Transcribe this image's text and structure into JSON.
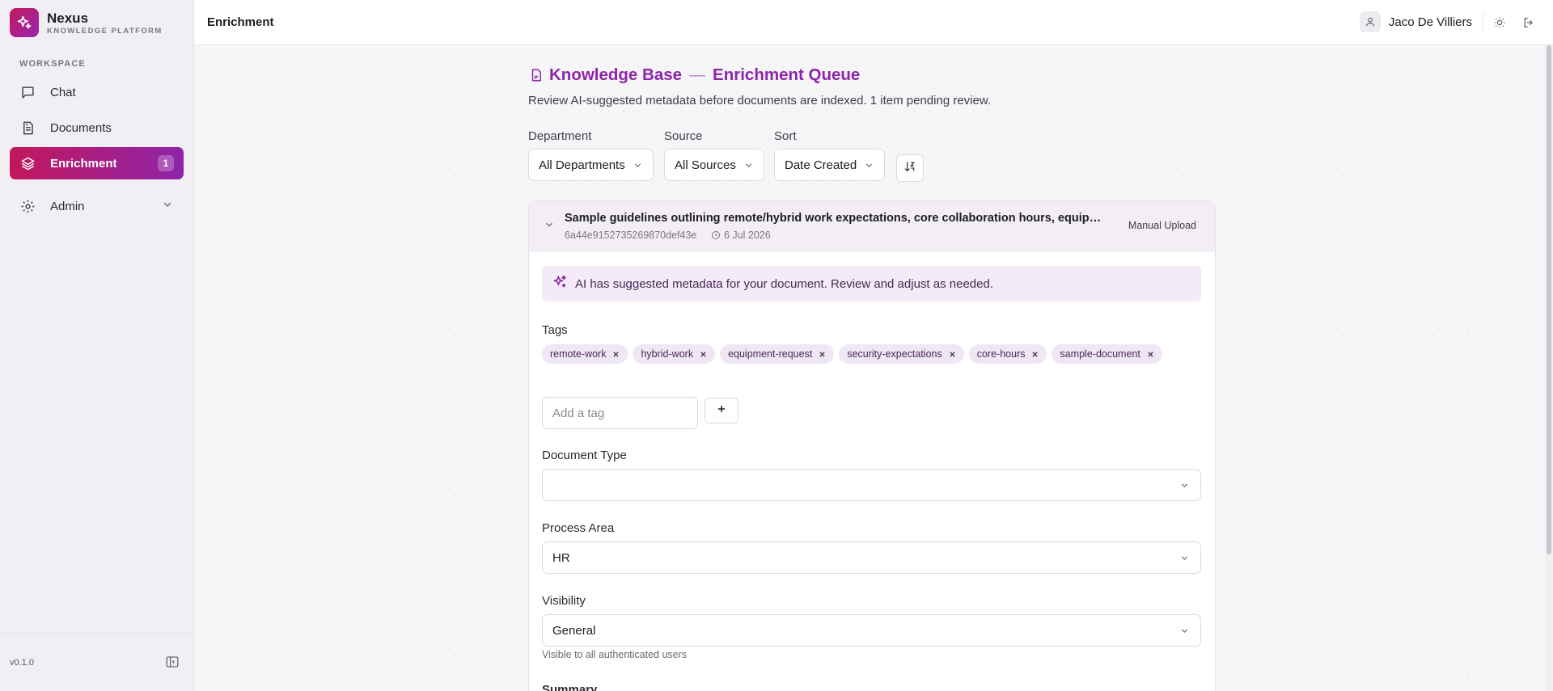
{
  "brand": {
    "name": "Nexus",
    "subtitle": "KNOWLEDGE PLATFORM"
  },
  "sidebar": {
    "section_label": "WORKSPACE",
    "items": [
      {
        "label": "Chat",
        "icon": "message-square-icon"
      },
      {
        "label": "Documents",
        "icon": "file-text-icon"
      },
      {
        "label": "Enrichment",
        "icon": "layers-icon",
        "badge": "1",
        "active": true
      },
      {
        "label": "Admin",
        "icon": "gear-icon"
      }
    ],
    "version": "v0.1.0"
  },
  "topbar": {
    "title": "Enrichment",
    "user_name": "Jaco De Villiers"
  },
  "page": {
    "title_part1": "Knowledge Base",
    "separator": "—",
    "title_part2": "Enrichment Queue",
    "description": "Review AI-suggested metadata before documents are indexed. 1 item pending review."
  },
  "filters": {
    "department": {
      "label": "Department",
      "value": "All Departments"
    },
    "source": {
      "label": "Source",
      "value": "All Sources"
    },
    "sort": {
      "label": "Sort",
      "value": "Date Created"
    }
  },
  "document": {
    "title": "Sample guidelines outlining remote/hybrid work expectations, core collaboration hours, equipment request process, and security expectations",
    "id": "6a44e9152735269870def43e",
    "date": "6 Jul 2026",
    "source": "Manual Upload",
    "ai_banner": "AI has suggested metadata for your document. Review and adjust as needed.",
    "tags_label": "Tags",
    "tags": [
      "remote-work",
      "hybrid-work",
      "equipment-request",
      "security-expectations",
      "core-hours",
      "sample-document"
    ],
    "tag_placeholder": "Add a tag",
    "document_type": {
      "label": "Document Type",
      "value": ""
    },
    "process_area": {
      "label": "Process Area",
      "value": "HR"
    },
    "visibility": {
      "label": "Visibility",
      "value": "General",
      "help": "Visible to all authenticated users"
    },
    "summary_label": "Summary"
  },
  "colors": {
    "accent": "#8e24aa",
    "accent_start": "#c2185b"
  }
}
